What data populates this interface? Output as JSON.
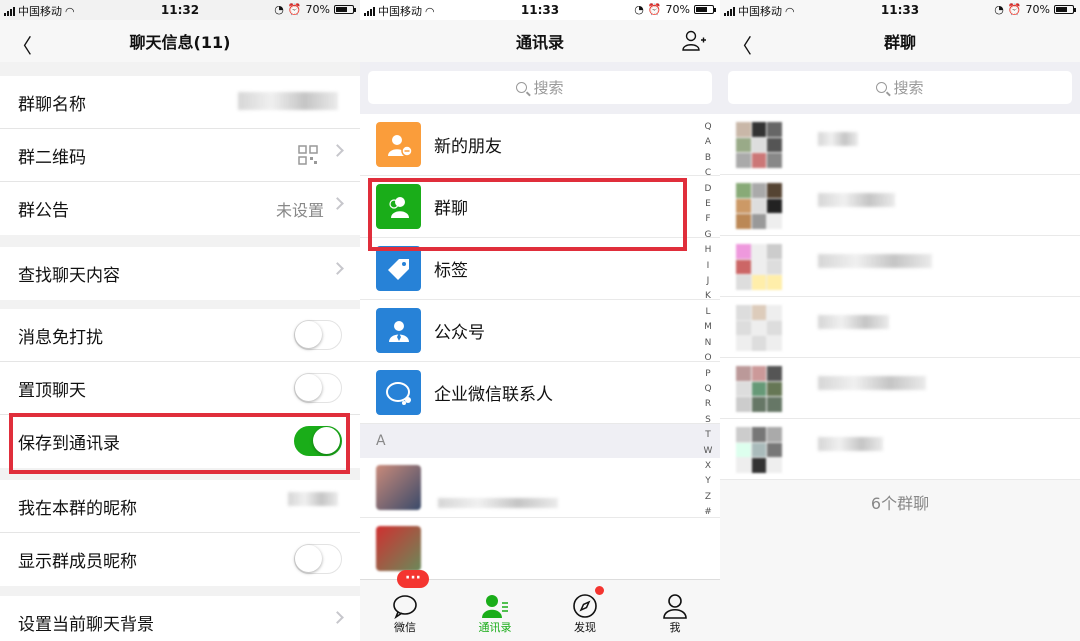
{
  "status_bars": [
    {
      "carrier": "中国移动",
      "time": "11:32",
      "battery": "70%"
    },
    {
      "carrier": "中国移动",
      "time": "11:33",
      "battery": "70%"
    },
    {
      "carrier": "中国移动",
      "time": "11:33",
      "battery": "70%"
    }
  ],
  "chat_info": {
    "title": "聊天信息(11)",
    "rows": {
      "group_name": "群聊名称",
      "qr_code": "群二维码",
      "announcement": "群公告",
      "announcement_value": "未设置",
      "search_history": "查找聊天内容",
      "mute": "消息免打扰",
      "mute_on": false,
      "pin": "置顶聊天",
      "pin_on": false,
      "save_to_contacts": "保存到通讯录",
      "save_on": true,
      "my_nickname": "我在本群的昵称",
      "show_nicknames": "显示群成员昵称",
      "show_nicknames_on": false,
      "set_background": "设置当前聊天背景"
    }
  },
  "contacts": {
    "title": "通讯录",
    "search_placeholder": "搜索",
    "items": [
      {
        "label": "新的朋友",
        "icon": "new-friend-icon",
        "color": "#fa9d3b"
      },
      {
        "label": "群聊",
        "icon": "group-chat-icon",
        "color": "#1aad19"
      },
      {
        "label": "标签",
        "icon": "tag-icon",
        "color": "#2782d7"
      },
      {
        "label": "公众号",
        "icon": "official-account-icon",
        "color": "#2782d7"
      },
      {
        "label": "企业微信联系人",
        "icon": "wecom-contact-icon",
        "color": "#2782d7"
      }
    ],
    "section": "A",
    "index": [
      "Q",
      "A",
      "B",
      "C",
      "D",
      "E",
      "F",
      "G",
      "H",
      "I",
      "J",
      "K",
      "L",
      "M",
      "N",
      "O",
      "P",
      "Q",
      "R",
      "S",
      "T",
      "W",
      "X",
      "Y",
      "Z",
      "#"
    ],
    "tabs": [
      {
        "label": "微信",
        "icon": "chat-bubble-icon",
        "badge": "···"
      },
      {
        "label": "通讯录",
        "icon": "contacts-icon"
      },
      {
        "label": "发现",
        "icon": "compass-icon"
      },
      {
        "label": "我",
        "icon": "person-icon"
      }
    ]
  },
  "group_chats": {
    "title": "群聊",
    "search_placeholder": "搜索",
    "count_label": "6个群聊"
  }
}
